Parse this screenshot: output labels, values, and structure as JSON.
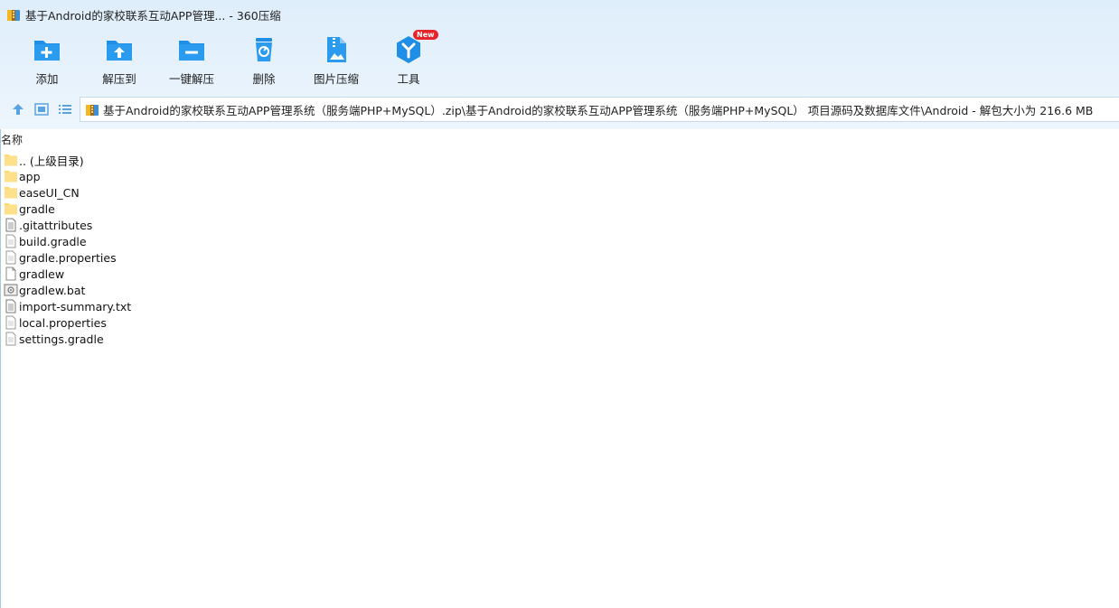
{
  "window": {
    "title": "基于Android的家校联系互动APP管理... - 360压缩"
  },
  "toolbar": {
    "items": [
      {
        "label": "添加",
        "icon": "add-folder-icon"
      },
      {
        "label": "解压到",
        "icon": "extract-to-icon"
      },
      {
        "label": "一键解压",
        "icon": "one-click-extract-icon"
      },
      {
        "label": "删除",
        "icon": "trash-icon"
      },
      {
        "label": "图片压缩",
        "icon": "image-compress-icon"
      },
      {
        "label": "工具",
        "icon": "tools-icon",
        "badge": "New"
      }
    ]
  },
  "address": {
    "path": "基于Android的家校联系互动APP管理系统（服务端PHP+MySQL）.zip\\基于Android的家校联系互动APP管理系统（服务端PHP+MySQL） 项目源码及数据库文件\\Android - 解包大小为 216.6 MB"
  },
  "list": {
    "column_name": "名称",
    "items": [
      {
        "name": ".. (上级目录)",
        "type": "folder"
      },
      {
        "name": "app",
        "type": "folder"
      },
      {
        "name": "easeUI_CN",
        "type": "folder"
      },
      {
        "name": "gradle",
        "type": "folder"
      },
      {
        "name": ".gitattributes",
        "type": "text"
      },
      {
        "name": "build.gradle",
        "type": "doc"
      },
      {
        "name": "gradle.properties",
        "type": "doc"
      },
      {
        "name": "gradlew",
        "type": "blank"
      },
      {
        "name": "gradlew.bat",
        "type": "bat"
      },
      {
        "name": "import-summary.txt",
        "type": "text"
      },
      {
        "name": "local.properties",
        "type": "doc"
      },
      {
        "name": "settings.gradle",
        "type": "doc"
      }
    ]
  },
  "colors": {
    "accent": "#1e8ee6",
    "folder": "#ffd86b",
    "badge": "#e8232b"
  }
}
